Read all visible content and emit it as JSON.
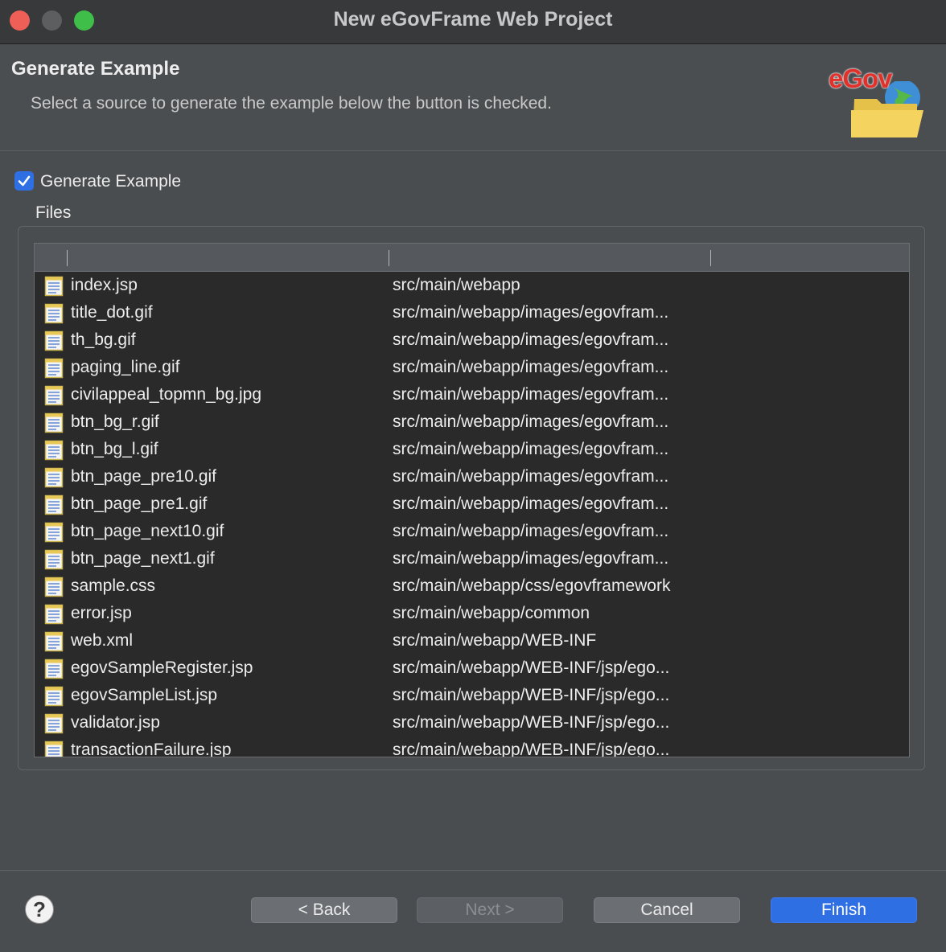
{
  "window": {
    "title": "New eGovFrame Web Project"
  },
  "header": {
    "title": "Generate Example",
    "description": "Select a source to generate the example below the button is checked.",
    "logo_text": "eGov"
  },
  "options": {
    "generate_example_label": "Generate Example",
    "generate_example_checked": true
  },
  "files": {
    "group_label": "Files",
    "columns": [
      "",
      "",
      ""
    ],
    "rows": [
      {
        "name": "index.jsp",
        "path": "src/main/webapp"
      },
      {
        "name": "title_dot.gif",
        "path": "src/main/webapp/images/egovfram..."
      },
      {
        "name": "th_bg.gif",
        "path": "src/main/webapp/images/egovfram..."
      },
      {
        "name": "paging_line.gif",
        "path": "src/main/webapp/images/egovfram..."
      },
      {
        "name": "civilappeal_topmn_bg.jpg",
        "path": "src/main/webapp/images/egovfram..."
      },
      {
        "name": "btn_bg_r.gif",
        "path": "src/main/webapp/images/egovfram..."
      },
      {
        "name": "btn_bg_l.gif",
        "path": "src/main/webapp/images/egovfram..."
      },
      {
        "name": "btn_page_pre10.gif",
        "path": "src/main/webapp/images/egovfram..."
      },
      {
        "name": "btn_page_pre1.gif",
        "path": "src/main/webapp/images/egovfram..."
      },
      {
        "name": "btn_page_next10.gif",
        "path": "src/main/webapp/images/egovfram..."
      },
      {
        "name": "btn_page_next1.gif",
        "path": "src/main/webapp/images/egovfram..."
      },
      {
        "name": "sample.css",
        "path": "src/main/webapp/css/egovframework"
      },
      {
        "name": "error.jsp",
        "path": "src/main/webapp/common"
      },
      {
        "name": "web.xml",
        "path": "src/main/webapp/WEB-INF"
      },
      {
        "name": "egovSampleRegister.jsp",
        "path": "src/main/webapp/WEB-INF/jsp/ego..."
      },
      {
        "name": "egovSampleList.jsp",
        "path": "src/main/webapp/WEB-INF/jsp/ego..."
      },
      {
        "name": "validator.jsp",
        "path": "src/main/webapp/WEB-INF/jsp/ego..."
      },
      {
        "name": "transactionFailure.jsp",
        "path": "src/main/webapp/WEB-INF/jsp/ego..."
      }
    ]
  },
  "buttons": {
    "help": "?",
    "back": "< Back",
    "next": "Next >",
    "cancel": "Cancel",
    "finish": "Finish"
  },
  "colors": {
    "accent": "#2f6fe4",
    "close": "#ee5f57",
    "maximize": "#3fbf4a",
    "logo": "#e2312a"
  },
  "icons": {
    "file": "document-icon",
    "help": "question-icon",
    "check": "checkmark-icon"
  }
}
